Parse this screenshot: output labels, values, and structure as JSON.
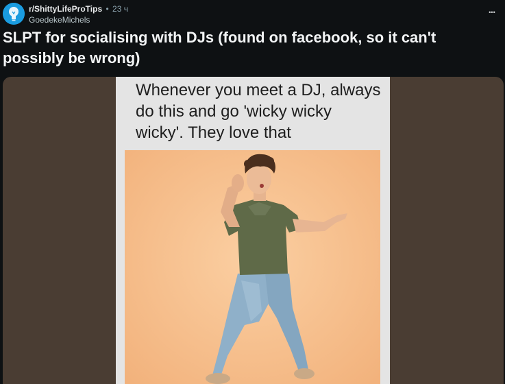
{
  "post": {
    "subreddit": "r/ShittyLifeProTips",
    "separator": "•",
    "time": "23 ч",
    "username": "GoedekeMichels",
    "more_icon": "•••",
    "title": "SLPT for socialising with DJs (found on facebook, so it can't possibly be wrong)"
  },
  "media": {
    "caption": "Whenever you meet a DJ, always do this and go 'wicky wicky wicky'. They love that",
    "background_color": "#4a3d33",
    "photo_background": "#f6be8e"
  }
}
